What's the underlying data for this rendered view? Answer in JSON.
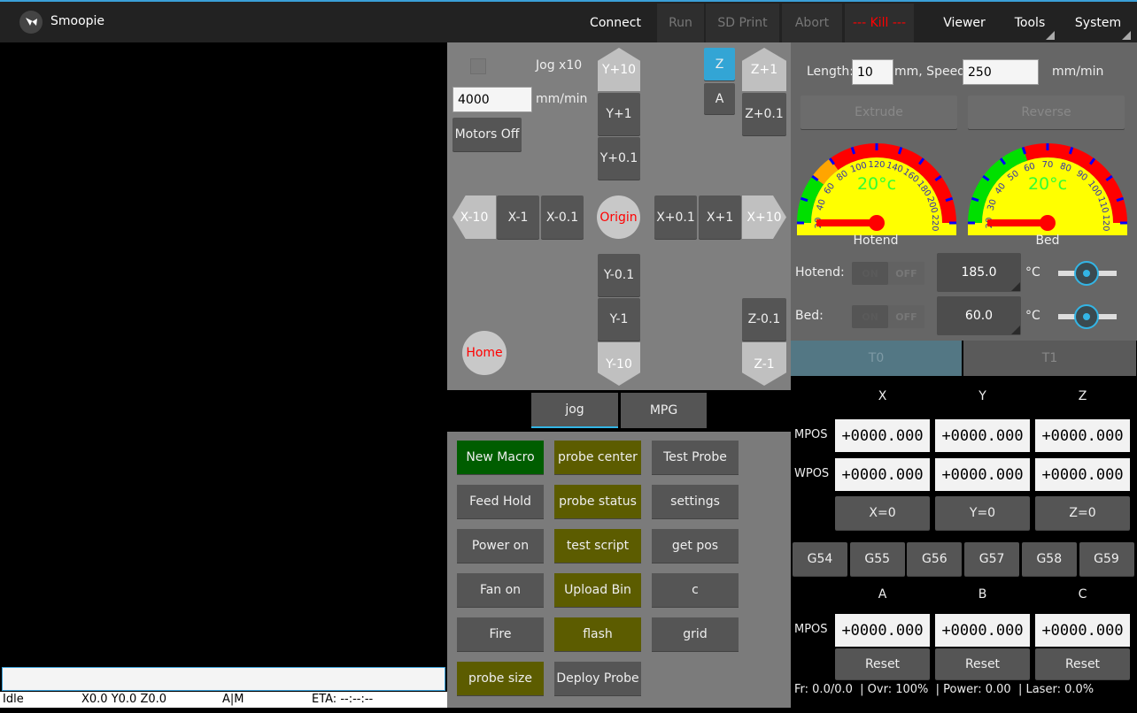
{
  "app": {
    "title": "Smoopie"
  },
  "header": {
    "connect": "Connect",
    "run": "Run",
    "sd_print": "SD Print",
    "abort": "Abort",
    "kill": "--- Kill  ---",
    "viewer": "Viewer",
    "tools": "Tools",
    "system": "System"
  },
  "console": {
    "input_value": ""
  },
  "status": {
    "state": "Idle",
    "position": "X0.0 Y0.0 Z0.0",
    "mode": "A|M",
    "eta": "ETA: --:--:--"
  },
  "jog": {
    "jog_x10_label": "Jog x10",
    "jog_x10_checked": false,
    "feed_value": "4000",
    "feed_unit": "mm/min",
    "motors_off": "Motors Off",
    "y_plus_10": "Y+10",
    "y_plus_1": "Y+1",
    "y_plus_01": "Y+0.1",
    "y_minus_01": "Y-0.1",
    "y_minus_1": "Y-1",
    "y_minus_10": "Y-10",
    "x_minus_10": "X-10",
    "x_minus_1": "X-1",
    "x_minus_01": "X-0.1",
    "x_plus_01": "X+0.1",
    "x_plus_1": "X+1",
    "x_plus_10": "X+10",
    "origin": "Origin",
    "home": "Home",
    "axis_z": "Z",
    "axis_a": "A",
    "z_plus_1": "Z+1",
    "z_plus_01": "Z+0.1",
    "z_minus_01": "Z-0.1",
    "z_minus_1": "Z-1"
  },
  "mode_tabs": [
    {
      "label": "jog",
      "active": true
    },
    {
      "label": "MPG",
      "active": false
    }
  ],
  "macros": [
    [
      "New Macro",
      "probe center",
      "Test Probe"
    ],
    [
      "Feed Hold",
      "probe status",
      "settings"
    ],
    [
      "Power on",
      "test script",
      "get pos"
    ],
    [
      "Fan on",
      "Upload Bin",
      "c"
    ],
    [
      "Fire",
      "flash",
      "grid"
    ],
    [
      "probe size",
      "Deploy Probe",
      ""
    ]
  ],
  "extruder": {
    "length_label": "Length:",
    "length_value": "10",
    "speed_label": "mm, Speed:",
    "speed_value": "250",
    "speed_unit": "mm/min",
    "extrude": "Extrude",
    "reverse": "Reverse"
  },
  "gauges": {
    "hotend": {
      "label": "Hotend",
      "value": 20,
      "display": "20°c",
      "min": 20,
      "max": 220,
      "ticks": [
        20,
        40,
        60,
        80,
        100,
        120,
        140,
        160,
        180,
        200,
        220
      ],
      "bands": [
        {
          "to": 60,
          "color": "#00e000"
        },
        {
          "to": 80,
          "color": "#ffa500"
        },
        {
          "to": 220,
          "color": "#ff0000"
        }
      ]
    },
    "bed": {
      "label": "Bed",
      "value": 20,
      "display": "20°c",
      "min": 20,
      "max": 120,
      "ticks": [
        20,
        30,
        40,
        50,
        60,
        70,
        80,
        90,
        100,
        110,
        120
      ],
      "bands": [
        {
          "to": 60,
          "color": "#00e000"
        },
        {
          "to": 120,
          "color": "#ff0000"
        }
      ]
    }
  },
  "heaters": {
    "hotend_label": "Hotend:",
    "hotend_setpoint": "185.0",
    "bed_label": "Bed:",
    "bed_setpoint": "60.0",
    "unit": "°C",
    "on": "ON",
    "off": "OFF"
  },
  "tool_tabs": [
    {
      "label": "T0",
      "active": true
    },
    {
      "label": "T1",
      "active": false
    }
  ],
  "dro": {
    "axes1": [
      "X",
      "Y",
      "Z"
    ],
    "axes2": [
      "A",
      "B",
      "C"
    ],
    "mpos_label": "MPOS",
    "wpos_label": "WPOS",
    "mpos1": [
      "+0000.000",
      "+0000.000",
      "+0000.000"
    ],
    "wpos1": [
      "+0000.000",
      "+0000.000",
      "+0000.000"
    ],
    "mpos2": [
      "+0000.000",
      "+0000.000",
      "+0000.000"
    ],
    "zero_buttons": [
      "X=0",
      "Y=0",
      "Z=0"
    ],
    "wcs": [
      "G54",
      "G55",
      "G56",
      "G57",
      "G58",
      "G59"
    ],
    "reset": "Reset"
  },
  "footer": {
    "text": "Fr: 0.0/0.0  | Ovr: 100%  | Power: 0.00  | Laser: 0.0%"
  },
  "colors": {
    "accent": "#33b5e5",
    "kill": "#ff0000",
    "macro_olive": "#5c5c00",
    "macro_green": "#005d00"
  }
}
